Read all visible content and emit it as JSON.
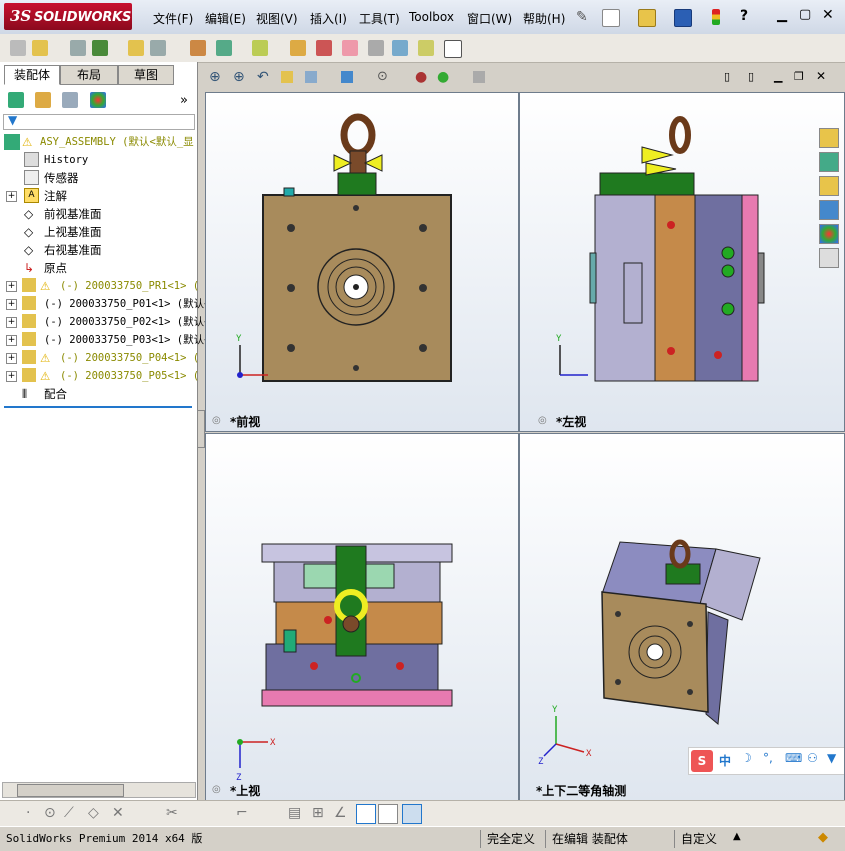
{
  "app": {
    "logo_text": "SOLIDWORKS"
  },
  "menu": [
    "文件(F)",
    "编辑(E)",
    "视图(V)",
    "插入(I)",
    "工具(T)",
    "Toolbox",
    "窗口(W)",
    "帮助(H)"
  ],
  "tabs": [
    "装配体",
    "布局",
    "草图"
  ],
  "tree": {
    "root": "ASY_ASSEMBLY  (默认<默认_显",
    "items": [
      {
        "label": "History",
        "icon": "history-icon"
      },
      {
        "label": "传感器",
        "icon": "sensor-icon"
      },
      {
        "label": "注解",
        "icon": "annotation-icon"
      },
      {
        "label": "前视基准面",
        "icon": "plane-icon"
      },
      {
        "label": "上视基准面",
        "icon": "plane-icon"
      },
      {
        "label": "右视基准面",
        "icon": "plane-icon"
      },
      {
        "label": "原点",
        "icon": "origin-icon"
      },
      {
        "label": "(-) 200033750_PR1<1> (",
        "icon": "part-warning-icon"
      },
      {
        "label": "(-) 200033750_P01<1> (默认<",
        "icon": "part-icon"
      },
      {
        "label": "(-) 200033750_P02<1> (默认<",
        "icon": "part-icon"
      },
      {
        "label": "(-) 200033750_P03<1> (默认<",
        "icon": "part-icon"
      },
      {
        "label": "(-) 200033750_P04<1> (",
        "icon": "part-warning-icon"
      },
      {
        "label": "(-) 200033750_P05<1> (",
        "icon": "part-warning-icon"
      },
      {
        "label": "配合",
        "icon": "mate-icon"
      }
    ]
  },
  "viewports": {
    "front": "*前视",
    "left": "*左视",
    "top": "*上视",
    "iso": "*上下二等角轴测"
  },
  "axes": {
    "x": "X",
    "y": "Y",
    "z": "Z"
  },
  "ime": {
    "lang": "中"
  },
  "status": {
    "product": "SolidWorks Premium 2014 x64 版",
    "defined": "完全定义",
    "editing": "在编辑 装配体",
    "custom": "自定义"
  },
  "colors": {
    "accent": "#c8102e",
    "tan": "#a88b5c",
    "green": "#1f7a1f"
  }
}
